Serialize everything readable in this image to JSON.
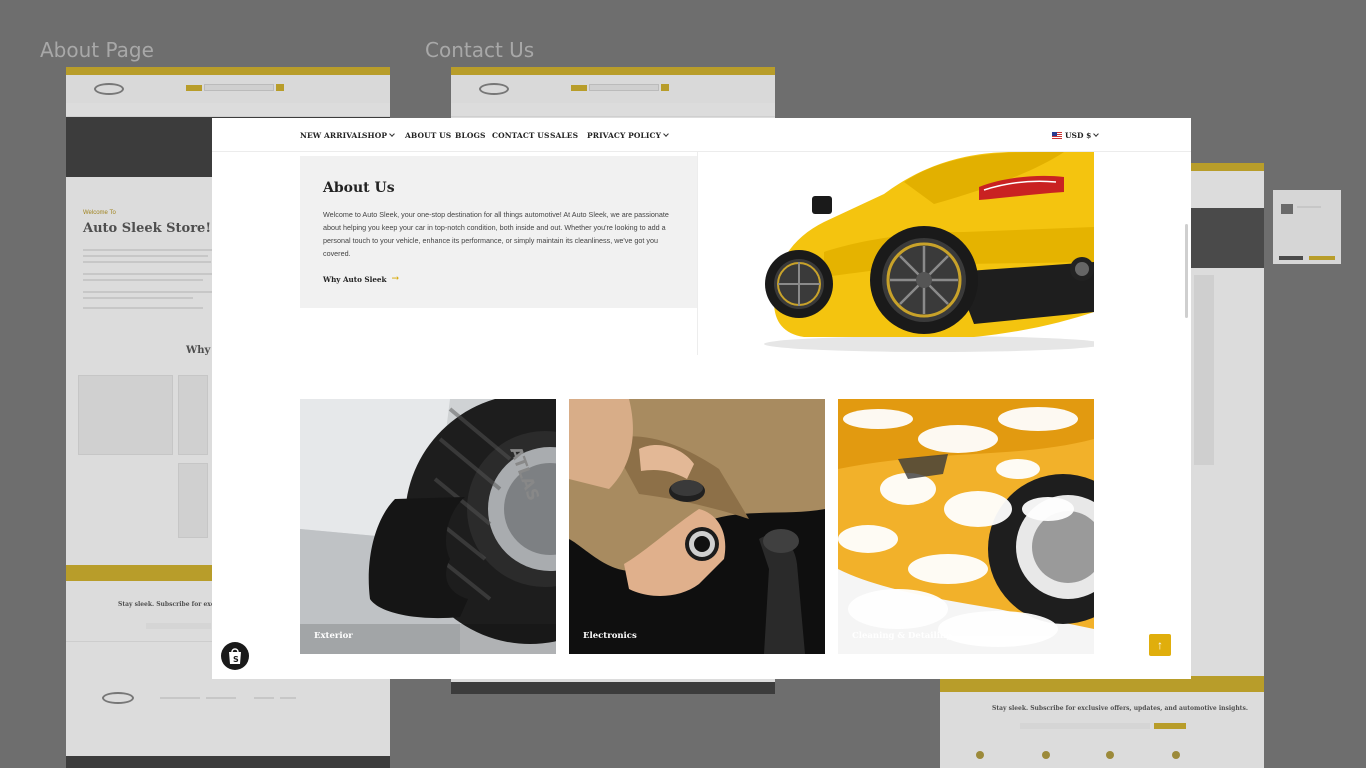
{
  "background": {
    "labels": [
      "About Page",
      "Contact Us"
    ],
    "left_thumb": {
      "welcome": "Welcome To",
      "store_title": "Auto Sleek Store!",
      "why": "Why",
      "subscribe": "Stay sleek. Subscribe for exclusi"
    },
    "right_thumb": {
      "subscribe": "Stay sleek. Subscribe for exclusive offers, updates, and automotive insights."
    }
  },
  "nav": {
    "items": [
      {
        "label": "NEW ARRIVAL",
        "dropdown": false
      },
      {
        "label": "SHOP",
        "dropdown": true
      },
      {
        "label": "ABOUT US",
        "dropdown": false
      },
      {
        "label": "BLOGS",
        "dropdown": false
      },
      {
        "label": "CONTACT US",
        "dropdown": false
      },
      {
        "label": "SALES",
        "dropdown": false
      },
      {
        "label": "PRIVACY POLICY",
        "dropdown": true
      }
    ],
    "currency": "USD $"
  },
  "about": {
    "title": "About Us",
    "body": "Welcome to Auto Sleek, your one-stop destination for all things automotive! At Auto Sleek, we are passionate about helping you keep your car in top-notch condition, both inside and out. Whether you're looking to add a personal touch to your vehicle, enhance its performance, or simply maintain its cleanliness, we've got you covered.",
    "link": "Why Auto Sleek",
    "link_arrow": "→"
  },
  "categories": [
    {
      "label": "Exterior"
    },
    {
      "label": "Electronics"
    },
    {
      "label": "Cleaning & Detailing"
    }
  ],
  "controls": {
    "back_to_top": "↑"
  },
  "colors": {
    "accent": "#e0ae0c",
    "dim_overlay": "#6e6e6e"
  }
}
